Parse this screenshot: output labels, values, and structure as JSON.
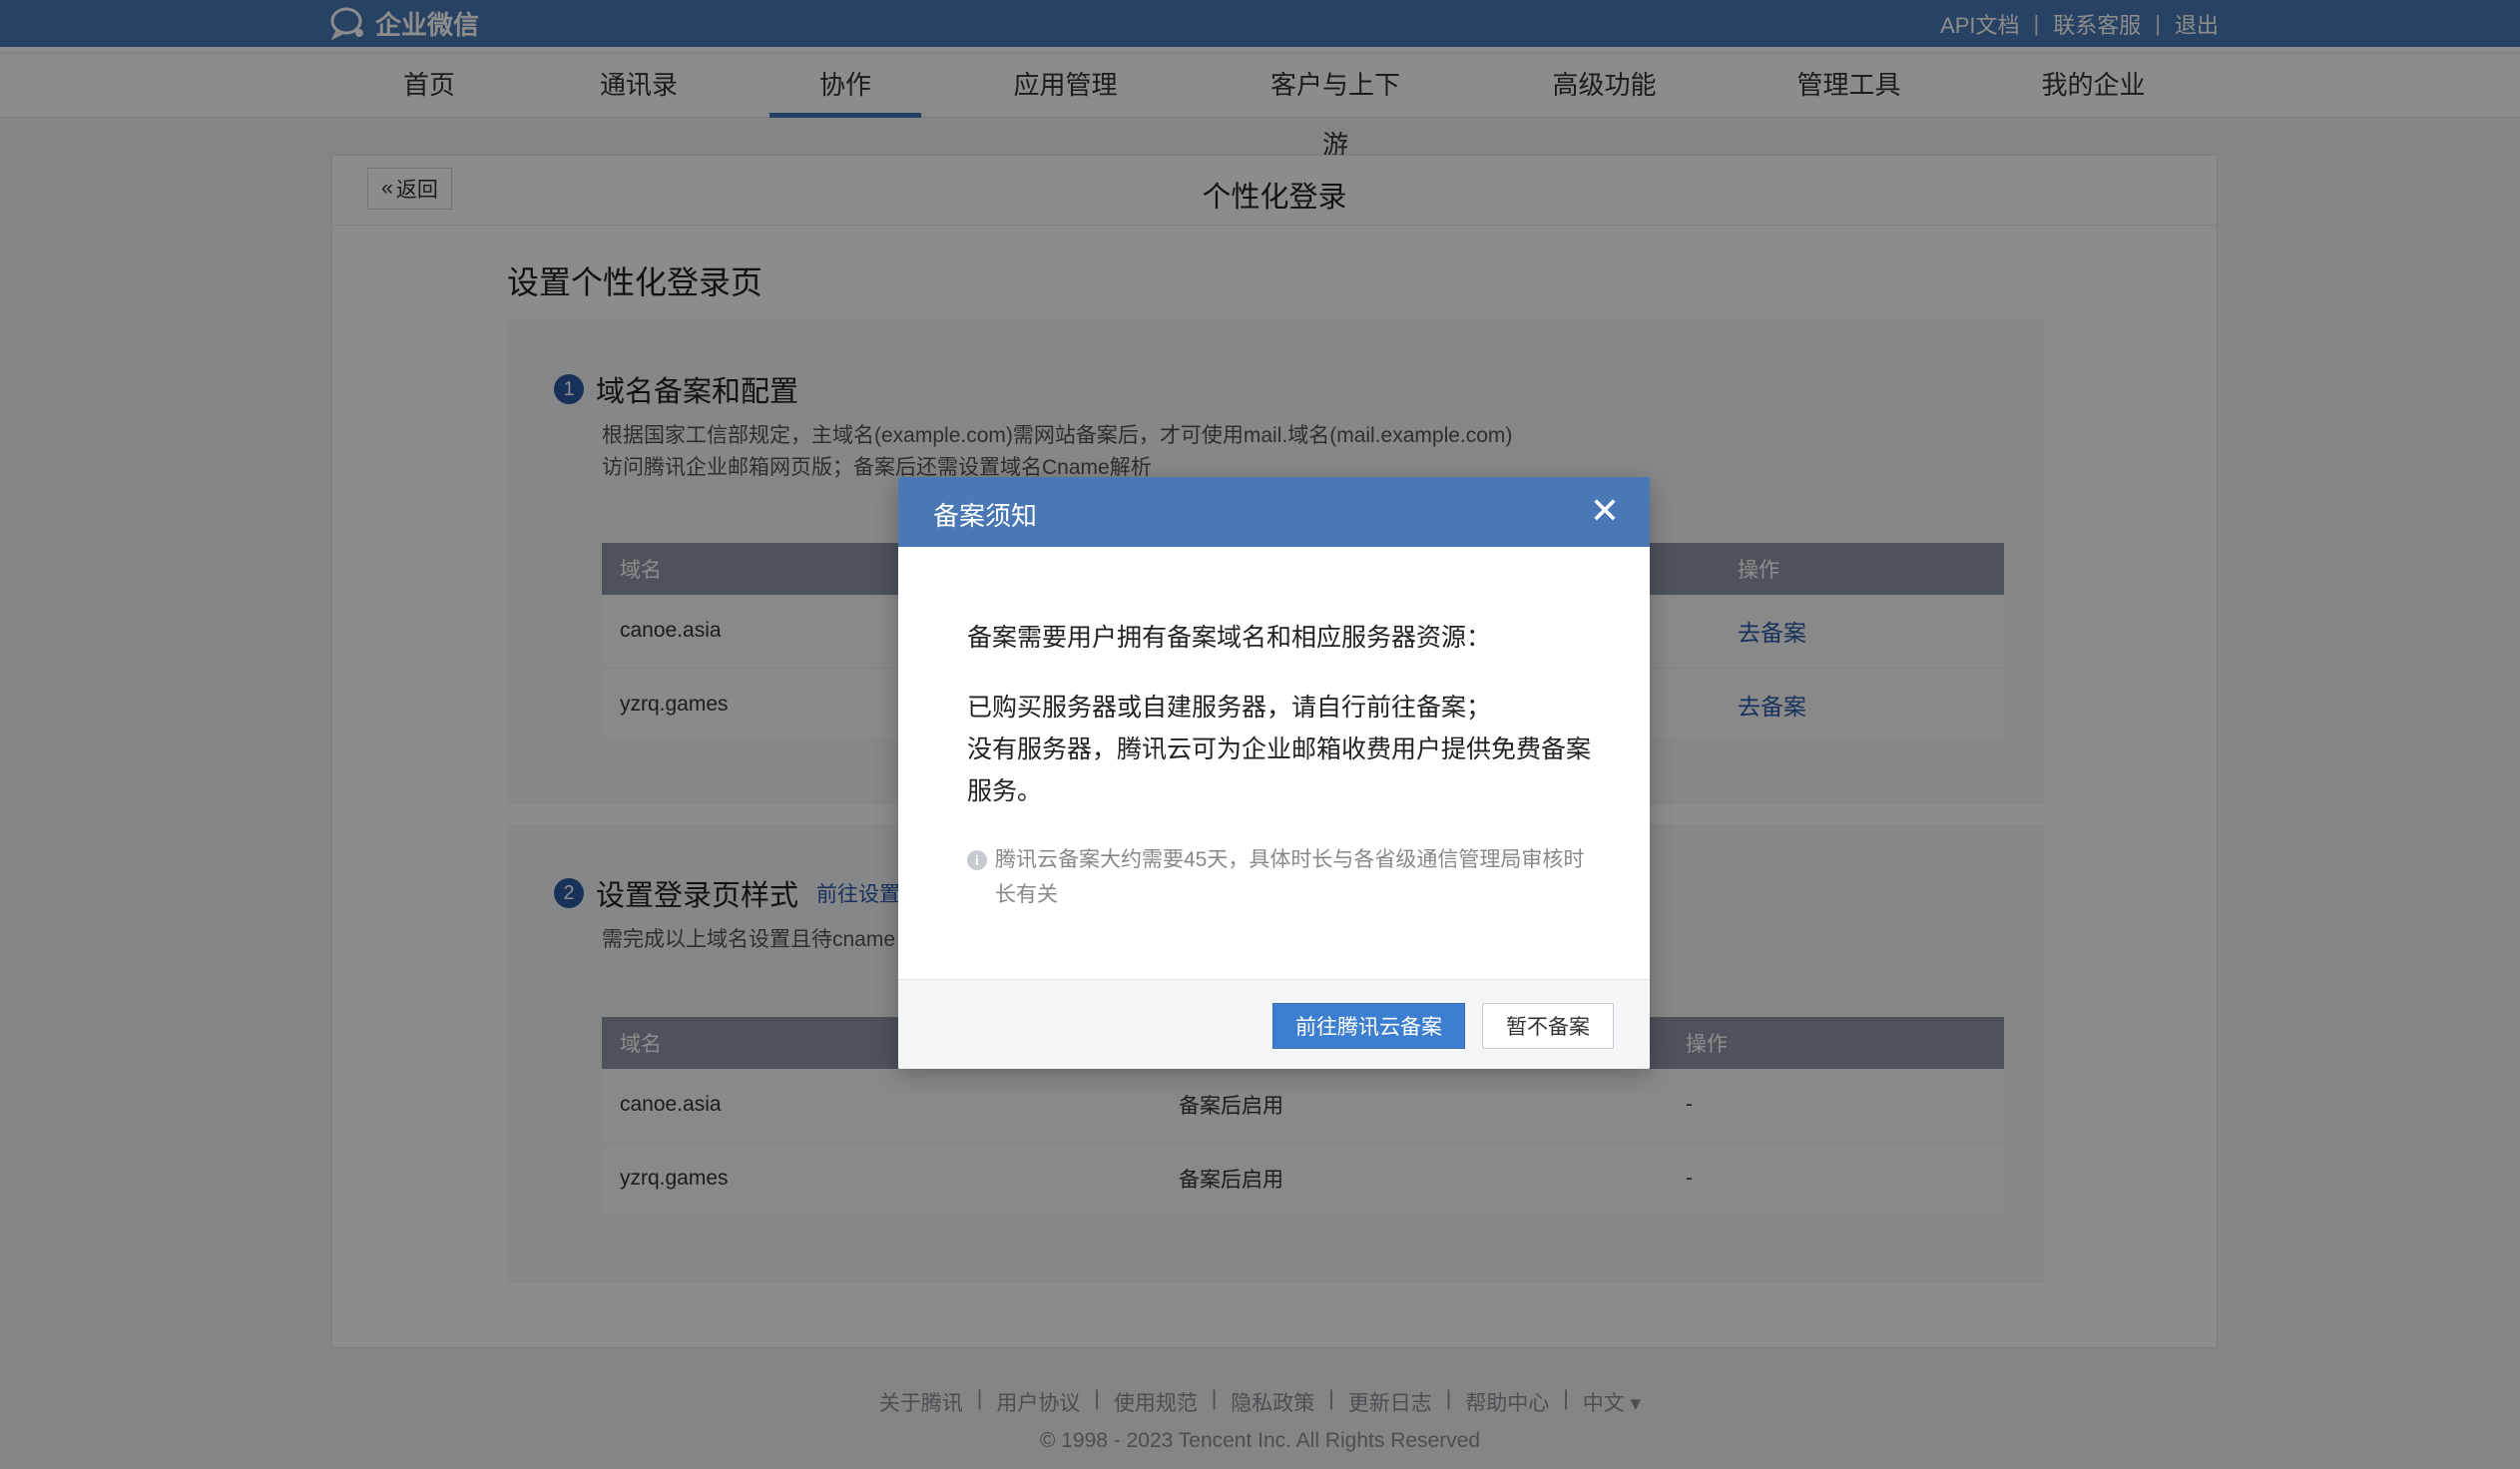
{
  "header": {
    "logo_text": "企业微信",
    "links": [
      "API文档",
      "联系客服",
      "退出"
    ],
    "separator": "|"
  },
  "nav": {
    "items": [
      "首页",
      "通讯录",
      "协作",
      "应用管理",
      "客户与上下游",
      "高级功能",
      "管理工具",
      "我的企业"
    ],
    "active_index": 2
  },
  "card": {
    "back_label": "返回",
    "back_icon": "«",
    "title": "个性化登录",
    "section_title": "设置个性化登录页",
    "step1": {
      "num": "1",
      "title": "域名备案和配置",
      "desc_line1": "根据国家工信部规定，主域名(example.com)需网站备案后，才可使用mail.域名(mail.example.com)",
      "desc_line2": "访问腾讯企业邮箱网页版；备案后还需设置域名Cname解析",
      "table": {
        "headers": [
          "域名",
          "",
          "操作"
        ],
        "rows": [
          {
            "domain": "canoe.asia",
            "action": "去备案"
          },
          {
            "domain": "yzrq.games",
            "action": "去备案"
          }
        ]
      }
    },
    "step2": {
      "num": "2",
      "title": "设置登录页样式",
      "link": "前往设置",
      "desc": "需完成以上域名设置且待cname",
      "table": {
        "headers": [
          "域名",
          "",
          "操作"
        ],
        "rows": [
          {
            "domain": "canoe.asia",
            "status": "备案后启用",
            "action": "-"
          },
          {
            "domain": "yzrq.games",
            "status": "备案后启用",
            "action": "-"
          }
        ]
      }
    }
  },
  "footer": {
    "links": [
      "关于腾讯",
      "用户协议",
      "使用规范",
      "隐私政策",
      "更新日志",
      "帮助中心",
      "中文 ▾"
    ],
    "copyright": "© 1998 - 2023 Tencent Inc. All Rights Reserved"
  },
  "modal": {
    "title": "备案须知",
    "close_icon": "✕",
    "line1": "备案需要用户拥有备案域名和相应服务器资源：",
    "line2": "已购买服务器或自建服务器，请自行前往备案；",
    "line3": "没有服务器，腾讯云可为企业邮箱收费用户提供免费备案",
    "line4": "服务。",
    "note_icon": "i",
    "note": "腾讯云备案大约需要45天，具体时长与各省级通信管理局审核时长有关",
    "primary_button": "前往腾讯云备案",
    "secondary_button": "暂不备案"
  },
  "colors": {
    "brand": "#4a78b4",
    "link": "#2a5ca8",
    "primary_button": "#3c7fd0"
  }
}
